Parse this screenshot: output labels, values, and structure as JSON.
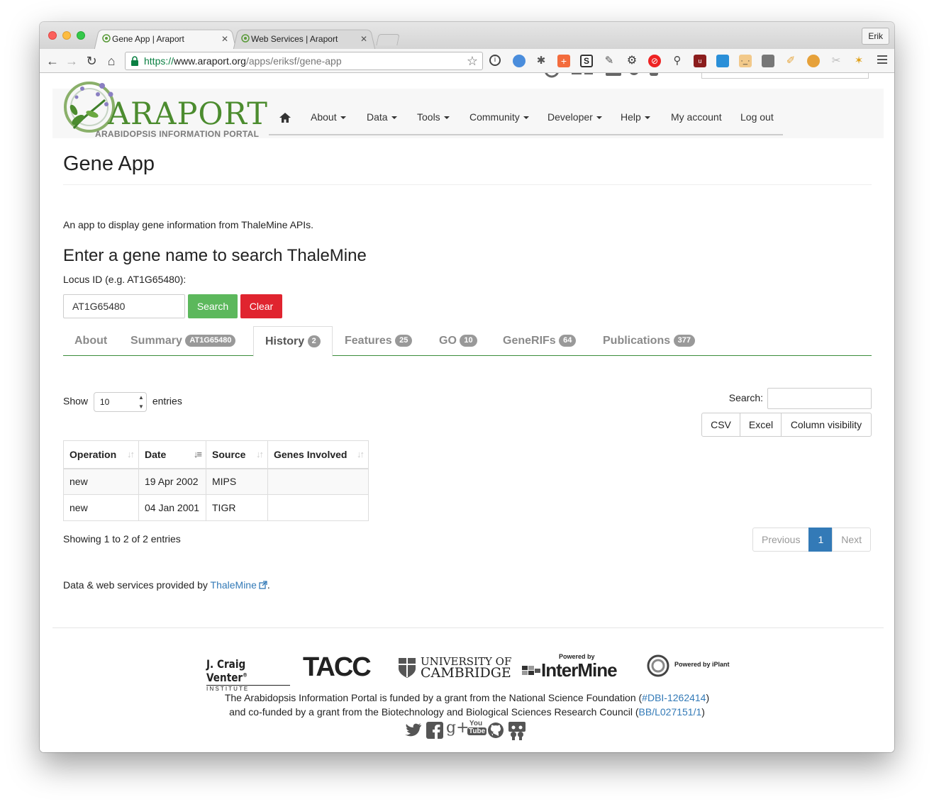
{
  "browser": {
    "tabs": [
      {
        "title": "Gene App | Araport",
        "active": true
      },
      {
        "title": "Web Services | Araport",
        "active": false
      }
    ],
    "profile": "Erik",
    "url": {
      "scheme": "https://",
      "host": "www.araport.org",
      "path": "/apps/eriksf/gene-app"
    }
  },
  "site": {
    "logo_word": "ARAPORT",
    "logo_sub": "ARABIDOPSIS INFORMATION PORTAL",
    "nav": [
      "About",
      "Data",
      "Tools",
      "Community",
      "Developer",
      "Help",
      "My account",
      "Log out"
    ]
  },
  "app": {
    "title": "Gene App",
    "intro": "An app to display gene information from ThaleMine APIs.",
    "search_heading": "Enter a gene name to search ThaleMine",
    "locus_label": "Locus ID (e.g. AT1G65480):",
    "locus_value": "AT1G65480",
    "search_button": "Search",
    "clear_button": "Clear"
  },
  "tabs": [
    {
      "label": "About",
      "badge": ""
    },
    {
      "label": "Summary",
      "badge": "AT1G65480"
    },
    {
      "label": "History",
      "badge": "2"
    },
    {
      "label": "Features",
      "badge": "25"
    },
    {
      "label": "GO",
      "badge": "10"
    },
    {
      "label": "GeneRIFs",
      "badge": "64"
    },
    {
      "label": "Publications",
      "badge": "377"
    }
  ],
  "datatable": {
    "show_label": "Show",
    "entries_value": "10",
    "entries_label": "entries",
    "search_label": "Search:",
    "buttons": [
      "CSV",
      "Excel",
      "Column visibility"
    ],
    "columns": [
      "Operation",
      "Date",
      "Source",
      "Genes Involved"
    ],
    "rows": [
      [
        "new",
        "19 Apr 2002",
        "MIPS",
        ""
      ],
      [
        "new",
        "04 Jan 2001",
        "TIGR",
        ""
      ]
    ],
    "info": "Showing 1 to 2 of 2 entries",
    "pager": {
      "previous": "Previous",
      "current": "1",
      "next": "Next"
    }
  },
  "credits": {
    "text": "Data & web services provided by ",
    "link": "ThaleMine",
    "end": "."
  },
  "footer": {
    "logos": {
      "jcvi_name": "J. Craig Venter",
      "jcvi_tm": "®",
      "jcvi_sub": "I N S T I T U T E",
      "tacc": "TACC",
      "cam_line1": "UNIVERSITY OF",
      "cam_line2": "CAMBRIDGE",
      "intermine_powered": "Powered by",
      "intermine_name": "InterMine",
      "iplant": "Powered by iPlant"
    },
    "line1_text": "The Arabidopsis Information Portal is funded by a grant from the National Science Foundation (",
    "line1_link": "#DBI-1262414",
    "line1_end": ")",
    "line2_text": "and co-funded by a grant from the Biotechnology and Biological Sciences Research Council (",
    "line2_link": "BB/L027151/1",
    "line2_end": ")",
    "youtube_top": "You",
    "youtube_bottom": "Tube"
  }
}
